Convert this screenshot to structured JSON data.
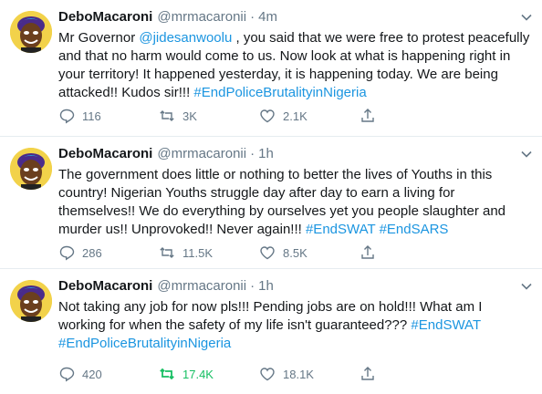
{
  "tweets": [
    {
      "name": "DeboMacaroni",
      "handle": "@mrmacaronii",
      "separator": "·",
      "time": "4m",
      "text_parts": [
        {
          "text": "Mr Governor ",
          "link": false
        },
        {
          "text": "@jidesanwoolu",
          "link": true
        },
        {
          "text": " , you said that we were free to protest peacefully and that no harm would come to us. Now look at what is happening right in your territory! It happened yesterday, it is happening today. We are being attacked!! Kudos sir!!! ",
          "link": false
        },
        {
          "text": "#EndPoliceBrutalityinNigeria",
          "link": true
        }
      ],
      "replies": "116",
      "retweets": "3K",
      "likes": "2.1K",
      "retweeted": false
    },
    {
      "name": "DeboMacaroni",
      "handle": "@mrmacaronii",
      "separator": "·",
      "time": "1h",
      "text_parts": [
        {
          "text": "The government does little or nothing to better the lives of Youths in this country! Nigerian Youths struggle day after day to earn a living for themselves!! We do everything by ourselves yet you people slaughter and murder us!! Unprovoked!! Never again!!! ",
          "link": false
        },
        {
          "text": "#EndSWAT",
          "link": true
        },
        {
          "text": " ",
          "link": false
        },
        {
          "text": "#EndSARS",
          "link": true
        }
      ],
      "replies": "286",
      "retweets": "11.5K",
      "likes": "8.5K",
      "retweeted": false
    },
    {
      "name": "DeboMacaroni",
      "handle": "@mrmacaronii",
      "separator": "·",
      "time": "1h",
      "text_parts": [
        {
          "text": "Not taking any job for now pls!!! Pending jobs are on hold!!! What am I working for when the safety of my life isn't guaranteed??? ",
          "link": false
        },
        {
          "text": "#EndSWAT",
          "link": true
        },
        {
          "text": " ",
          "link": false
        },
        {
          "text": "#EndPoliceBrutalityinNigeria",
          "link": true
        }
      ],
      "replies": "420",
      "retweets": "17.4K",
      "likes": "18.1K",
      "retweeted": true
    }
  ],
  "icons": {
    "reply": "reply-icon",
    "retweet": "retweet-icon",
    "like": "heart-icon",
    "share": "share-icon",
    "menu": "chevron-down-icon"
  },
  "colors": {
    "link": "#1b95e0",
    "muted": "#657786",
    "retweet_active": "#17bf63",
    "text": "#14171a",
    "divider": "#e6ecf0"
  }
}
